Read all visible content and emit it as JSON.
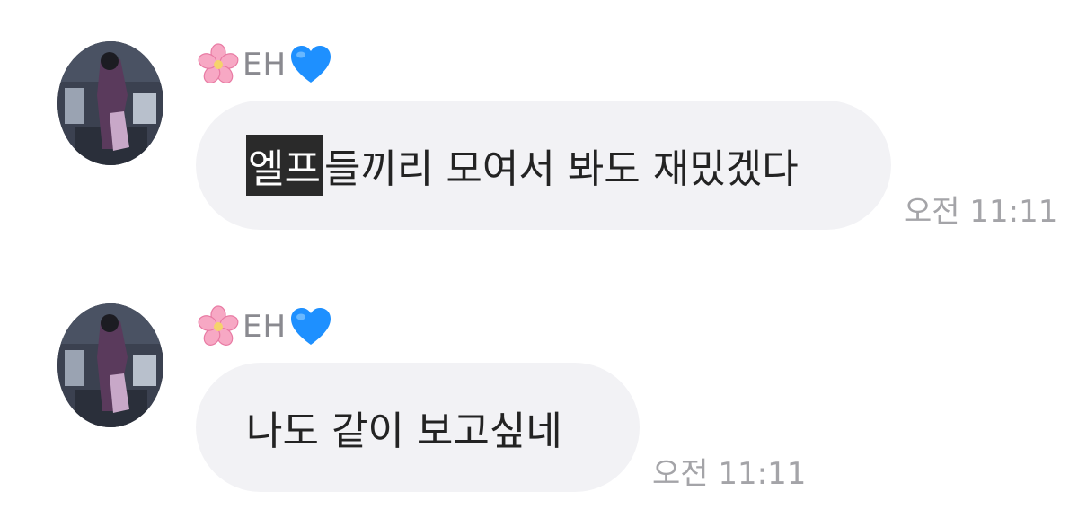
{
  "messages": [
    {
      "sender_name": "EH",
      "sender_prefix_icon": "cherry-blossom-icon",
      "sender_suffix_icon": "blue-heart-icon",
      "text_highlighted": "엘프",
      "text_rest": "들끼리 모여서 봐도 재밌겠다",
      "time": "오전 11:11"
    },
    {
      "sender_name": "EH",
      "sender_prefix_icon": "cherry-blossom-icon",
      "sender_suffix_icon": "blue-heart-icon",
      "text": "나도 같이 보고싶네",
      "time": "오전 11:11"
    }
  ],
  "colors": {
    "bubble": "#f2f2f5",
    "highlight_bg": "#2a2a2a",
    "time_text": "#a4a4a8",
    "heart": "#1e90ff",
    "blossom": "#f7a8c4"
  }
}
